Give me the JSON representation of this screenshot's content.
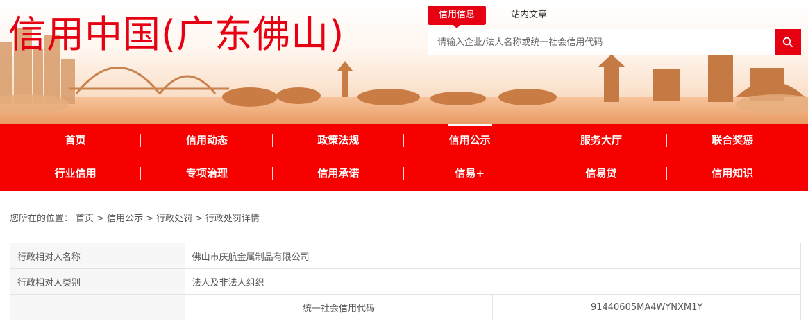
{
  "header": {
    "site_title": "信用中国(广东佛山)",
    "search_tabs": [
      "信用信息",
      "站内文章"
    ],
    "search_placeholder": "请输入企业/法人名称或统一社会信用代码"
  },
  "nav": {
    "row1": [
      "首页",
      "信用动态",
      "政策法规",
      "信用公示",
      "服务大厅",
      "联合奖惩"
    ],
    "row2": [
      "行业信用",
      "专项治理",
      "信用承诺",
      "信易+",
      "信易贷",
      "信用知识"
    ]
  },
  "breadcrumb": {
    "prefix": "您所在的位置：",
    "items": [
      "首页",
      "信用公示",
      "行政处罚",
      "行政处罚详情"
    ]
  },
  "details": {
    "rows": [
      {
        "label": "行政相对人名称",
        "value": "佛山市庆航金属制品有限公司"
      },
      {
        "label": "行政相对人类别",
        "value": "法人及非法人组织"
      }
    ],
    "sub_row": {
      "label": "统一社会信用代码",
      "value": "91440605MA4WYNXM1Y"
    }
  },
  "colors": {
    "brand": "#e60012",
    "nav": "#f70000"
  }
}
